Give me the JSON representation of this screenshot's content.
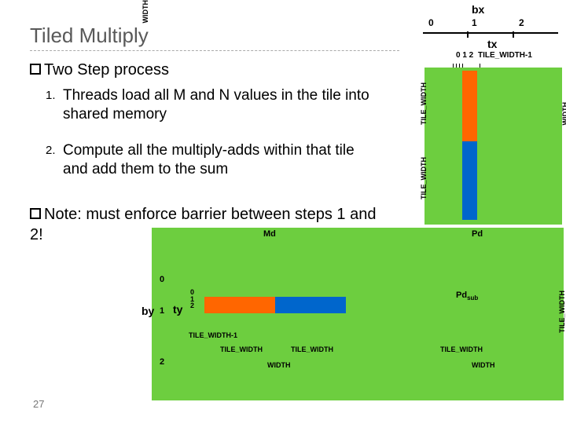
{
  "title": "Tiled Multiply",
  "main1_prefix": "Two",
  "main1_rest": " Step process",
  "num1": "1.",
  "num2": "2.",
  "sub1": "Threads load all M and N values in the tile into shared memory",
  "sub2": "Compute all the multiply-adds within that tile and add them to the sum",
  "main2_prefix": "Note:",
  "main2_rest": " must enforce barrier between steps 1 and 2!",
  "page": "27",
  "bx": "bx",
  "tx": "tx",
  "b0": "0",
  "b1": "1",
  "b2": "2",
  "t012": "0 1 2",
  "tile_width": "TILE_WIDTH",
  "tile_width_m1": "TILE_WIDTH-1",
  "width": "WIDTH",
  "by": "by",
  "ty": "ty",
  "md": "Md",
  "pd": "Pd",
  "pdsub": "Pd",
  "pdsub_s": "sub"
}
